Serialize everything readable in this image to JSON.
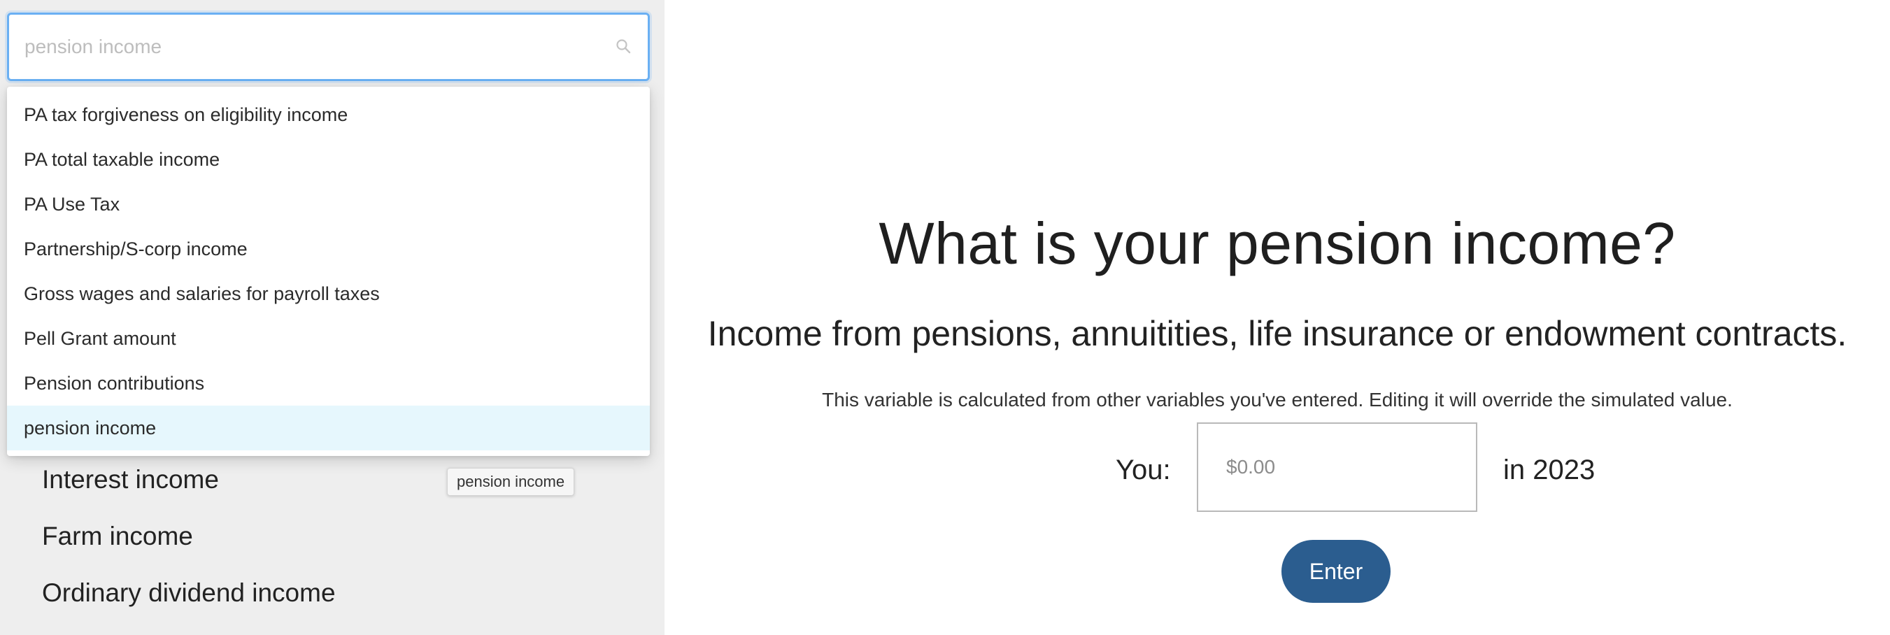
{
  "search": {
    "placeholder": "pension income",
    "value": ""
  },
  "dropdown": {
    "items": [
      {
        "label": "PA tax forgiveness on eligibility income"
      },
      {
        "label": "PA total taxable income"
      },
      {
        "label": "PA Use Tax"
      },
      {
        "label": "Partnership/S-corp income"
      },
      {
        "label": "Gross wages and salaries for payroll taxes"
      },
      {
        "label": "Pell Grant amount"
      },
      {
        "label": "Pension contributions"
      },
      {
        "label": "pension income"
      }
    ],
    "selected_index": 7
  },
  "sidebar": {
    "items": [
      {
        "label": "Interest income"
      },
      {
        "label": "Farm income"
      },
      {
        "label": "Ordinary dividend income"
      }
    ],
    "tooltip": "pension income"
  },
  "question": {
    "title": "What is your pension income?",
    "description": "Income from pensions, annuitities, life insurance or endowment contracts.",
    "note": "This variable is calculated from other variables you've entered. Editing it will override the simulated value.",
    "you_label": "You:",
    "input_placeholder": "$0.00",
    "year_label": "in 2023",
    "enter_label": "Enter"
  },
  "colors": {
    "sidebar_bg": "#eeeeee",
    "focus_border": "#6ab0f3",
    "selected_item_bg": "#e6f7fd",
    "enter_button_bg": "#2b5d8f"
  },
  "icons": {
    "search": "search-icon"
  }
}
